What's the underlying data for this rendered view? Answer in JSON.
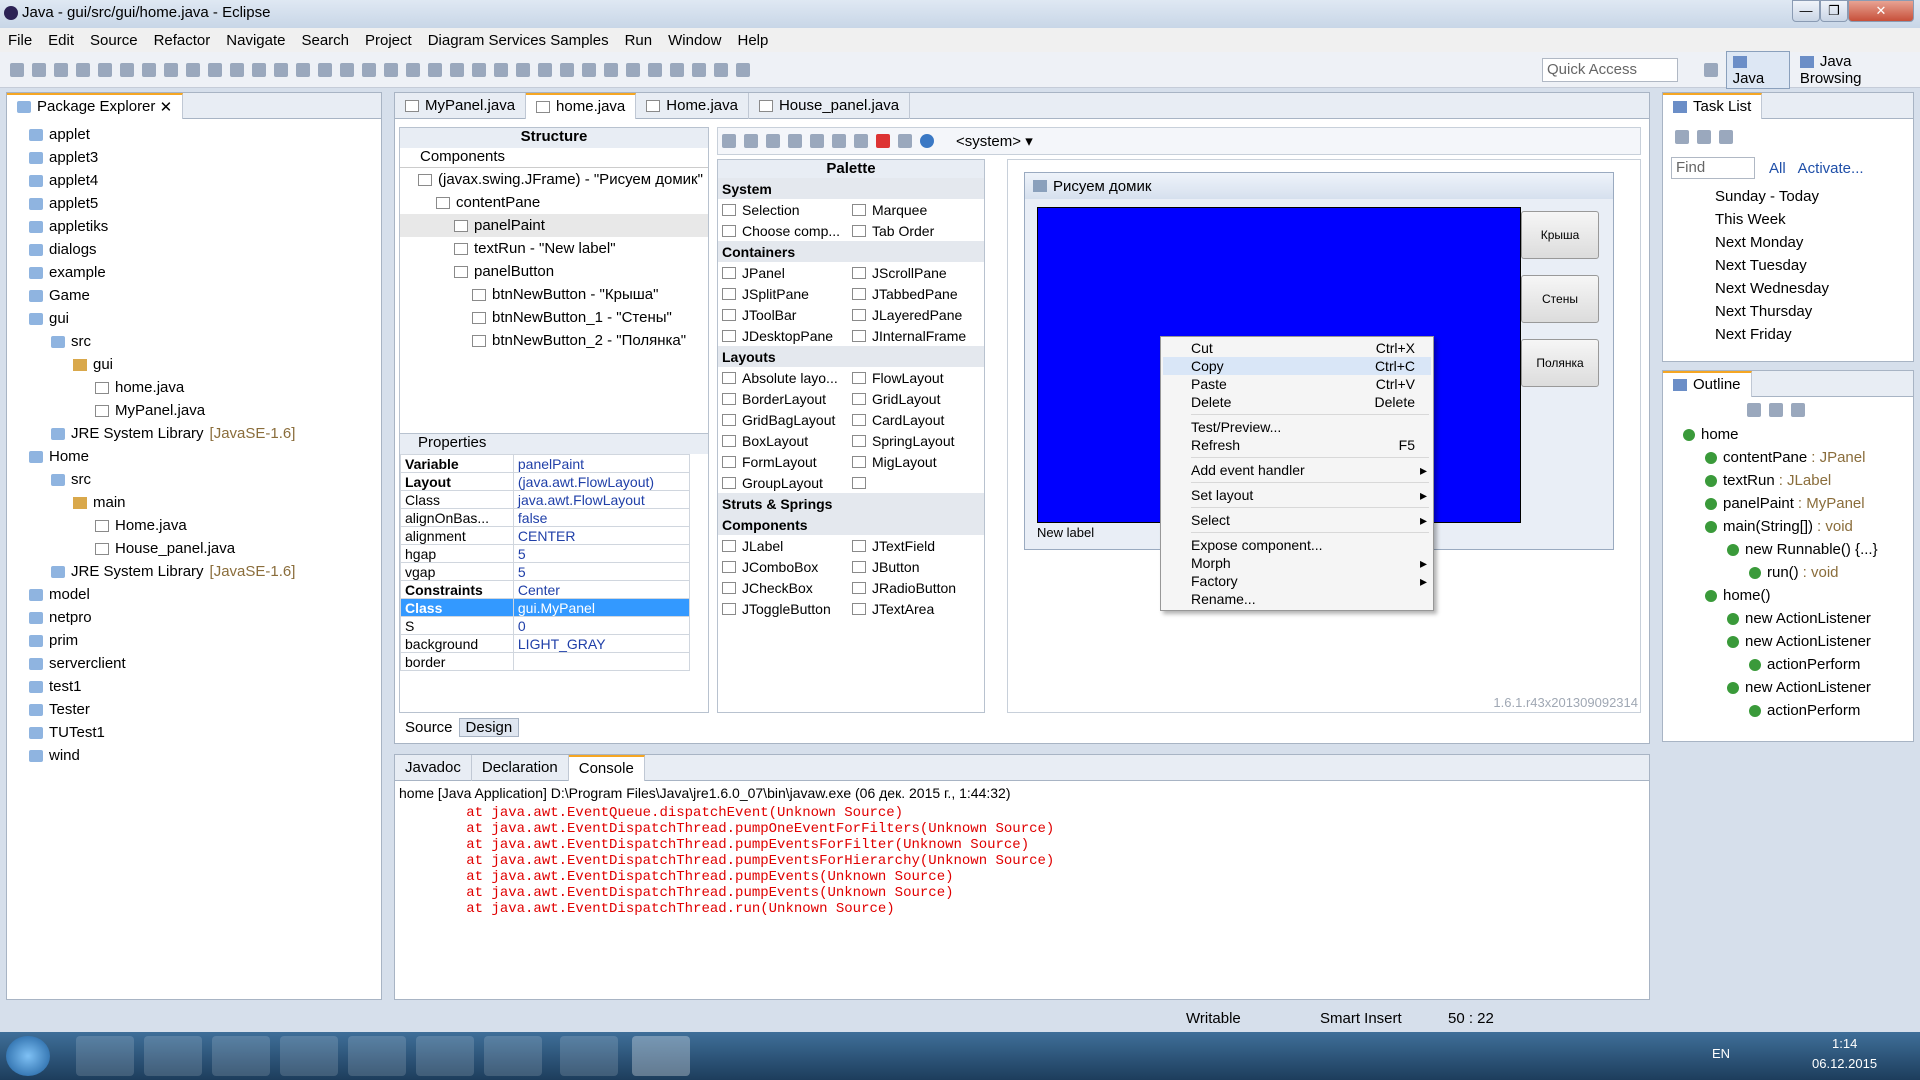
{
  "window": {
    "title": "Java - gui/src/gui/home.java - Eclipse"
  },
  "menu": [
    "File",
    "Edit",
    "Source",
    "Refactor",
    "Navigate",
    "Search",
    "Project",
    "Diagram Services Samples",
    "Run",
    "Window",
    "Help"
  ],
  "toolbar": {
    "quick_access": "Quick Access",
    "perspectives": [
      "Java",
      "Java Browsing"
    ]
  },
  "package_explorer": {
    "title": "Package Explorer",
    "items": [
      {
        "label": "applet",
        "indent": 1
      },
      {
        "label": "applet3",
        "indent": 1
      },
      {
        "label": "applet4",
        "indent": 1
      },
      {
        "label": "applet5",
        "indent": 1
      },
      {
        "label": "appletiks",
        "indent": 1
      },
      {
        "label": "dialogs",
        "indent": 1
      },
      {
        "label": "example",
        "indent": 1
      },
      {
        "label": "Game",
        "indent": 1
      },
      {
        "label": "gui",
        "indent": 1
      },
      {
        "label": "src",
        "indent": 2
      },
      {
        "label": "gui",
        "indent": 3
      },
      {
        "label": "home.java",
        "indent": 4
      },
      {
        "label": "MyPanel.java",
        "indent": 4
      },
      {
        "label": "JRE System Library",
        "extra": "[JavaSE-1.6]",
        "indent": 2
      },
      {
        "label": "Home",
        "indent": 1
      },
      {
        "label": "src",
        "indent": 2
      },
      {
        "label": "main",
        "indent": 3
      },
      {
        "label": "Home.java",
        "indent": 4
      },
      {
        "label": "House_panel.java",
        "indent": 4
      },
      {
        "label": "JRE System Library",
        "extra": "[JavaSE-1.6]",
        "indent": 2
      },
      {
        "label": "model",
        "indent": 1
      },
      {
        "label": "netpro",
        "indent": 1
      },
      {
        "label": "prim",
        "indent": 1
      },
      {
        "label": "serverclient",
        "indent": 1
      },
      {
        "label": "test1",
        "indent": 1
      },
      {
        "label": "Tester",
        "indent": 1
      },
      {
        "label": "TUTest1",
        "indent": 1
      },
      {
        "label": "wind",
        "indent": 1
      }
    ]
  },
  "editor_tabs": [
    "MyPanel.java",
    "home.java",
    "Home.java",
    "House_panel.java"
  ],
  "structure": {
    "title": "Structure",
    "components_label": "Components",
    "tree": [
      "(javax.swing.JFrame) - \"Рисуем домик\"",
      "contentPane",
      "panelPaint",
      "textRun - \"New label\"",
      "panelButton",
      "btnNewButton - \"Крыша\"",
      "btnNewButton_1 - \"Стены\"",
      "btnNewButton_2 - \"Полянка\""
    ]
  },
  "properties": {
    "title": "Properties",
    "rows": [
      [
        "Variable",
        "panelPaint"
      ],
      [
        "Layout",
        "(java.awt.FlowLayout)"
      ],
      [
        "Class",
        "java.awt.FlowLayout"
      ],
      [
        "alignOnBas...",
        "false"
      ],
      [
        "alignment",
        "CENTER"
      ],
      [
        "hgap",
        "5"
      ],
      [
        "vgap",
        "5"
      ],
      [
        "Constraints",
        "Center"
      ],
      [
        "Class",
        "gui.MyPanel"
      ],
      [
        "S",
        "0"
      ],
      [
        "background",
        "LIGHT_GRAY"
      ],
      [
        "border",
        ""
      ]
    ]
  },
  "palette": {
    "title": "Palette",
    "system_label": "<system>",
    "groups": [
      {
        "name": "System",
        "items": [
          "Selection",
          "Marquee",
          "Choose comp...",
          "Tab Order"
        ]
      },
      {
        "name": "Containers",
        "items": [
          "JPanel",
          "JScrollPane",
          "JSplitPane",
          "JTabbedPane",
          "JToolBar",
          "JLayeredPane",
          "JDesktopPane",
          "JInternalFrame"
        ]
      },
      {
        "name": "Layouts",
        "items": [
          "Absolute layo...",
          "FlowLayout",
          "BorderLayout",
          "GridLayout",
          "GridBagLayout",
          "CardLayout",
          "BoxLayout",
          "SpringLayout",
          "FormLayout",
          "MigLayout",
          "GroupLayout",
          ""
        ]
      },
      {
        "name": "Struts & Springs",
        "items": []
      },
      {
        "name": "Components",
        "items": [
          "JLabel",
          "JTextField",
          "JComboBox",
          "JButton",
          "JCheckBox",
          "JRadioButton",
          "JToggleButton",
          "JTextArea"
        ]
      }
    ]
  },
  "design": {
    "frame_title": "Рисуем домик",
    "buttons": [
      "Крыша",
      "Стены",
      "Полянка"
    ],
    "label": "New label",
    "version": "1.6.1.r43x201309092314"
  },
  "context_menu": [
    {
      "label": "Cut",
      "shortcut": "Ctrl+X"
    },
    {
      "label": "Copy",
      "shortcut": "Ctrl+C"
    },
    {
      "label": "Paste",
      "shortcut": "Ctrl+V"
    },
    {
      "label": "Delete",
      "shortcut": "Delete"
    },
    {
      "sep": true
    },
    {
      "label": "Test/Preview...",
      "shortcut": ""
    },
    {
      "label": "Refresh",
      "shortcut": "F5"
    },
    {
      "sep": true
    },
    {
      "label": "Add event handler",
      "shortcut": "",
      "sub": true
    },
    {
      "sep": true
    },
    {
      "label": "Set layout",
      "shortcut": "",
      "sub": true
    },
    {
      "sep": true
    },
    {
      "label": "Select",
      "shortcut": "",
      "sub": true
    },
    {
      "sep": true
    },
    {
      "label": "Expose component...",
      "shortcut": ""
    },
    {
      "label": "Morph",
      "shortcut": "",
      "sub": true
    },
    {
      "label": "Factory",
      "shortcut": "",
      "sub": true
    },
    {
      "label": "Rename...",
      "shortcut": ""
    }
  ],
  "bottom_tabs": {
    "source": "Source",
    "design": "Design"
  },
  "console": {
    "tabs": [
      "Javadoc",
      "Declaration",
      "Console"
    ],
    "header": "home [Java Application] D:\\Program Files\\Java\\jre1.6.0_07\\bin\\javaw.exe (06 дек. 2015 г., 1:44:32)",
    "lines": [
      "        at java.awt.EventQueue.dispatchEvent(Unknown Source)",
      "        at java.awt.EventDispatchThread.pumpOneEventForFilters(Unknown Source)",
      "        at java.awt.EventDispatchThread.pumpEventsForFilter(Unknown Source)",
      "        at java.awt.EventDispatchThread.pumpEventsForHierarchy(Unknown Source)",
      "        at java.awt.EventDispatchThread.pumpEvents(Unknown Source)",
      "        at java.awt.EventDispatchThread.pumpEvents(Unknown Source)",
      "        at java.awt.EventDispatchThread.run(Unknown Source)"
    ]
  },
  "task_list": {
    "title": "Task List",
    "find": "Find",
    "all": "All",
    "activate": "Activate...",
    "items": [
      "Sunday - Today",
      "This Week",
      "Next Monday",
      "Next Tuesday",
      "Next Wednesday",
      "Next Thursday",
      "Next Friday"
    ]
  },
  "outline": {
    "title": "Outline",
    "items": [
      {
        "label": "home",
        "type": "",
        "indent": 0
      },
      {
        "label": "contentPane",
        "type": ": JPanel",
        "indent": 1
      },
      {
        "label": "textRun",
        "type": ": JLabel",
        "indent": 1
      },
      {
        "label": "panelPaint",
        "type": ": MyPanel",
        "indent": 1
      },
      {
        "label": "main(String[])",
        "type": ": void",
        "indent": 1
      },
      {
        "label": "new Runnable() {...}",
        "type": "",
        "indent": 2
      },
      {
        "label": "run()",
        "type": ": void",
        "indent": 3
      },
      {
        "label": "home()",
        "type": "",
        "indent": 1
      },
      {
        "label": "new ActionListener",
        "type": "",
        "indent": 2
      },
      {
        "label": "new ActionListener",
        "type": "",
        "indent": 2
      },
      {
        "label": "actionPerform",
        "type": "",
        "indent": 3
      },
      {
        "label": "new ActionListener",
        "type": "",
        "indent": 2
      },
      {
        "label": "actionPerform",
        "type": "",
        "indent": 3
      }
    ]
  },
  "status": {
    "writable": "Writable",
    "insert": "Smart Insert",
    "pos": "50 : 22"
  },
  "taskbar": {
    "lang": "EN",
    "time": "1:14",
    "date": "06.12.2015"
  }
}
